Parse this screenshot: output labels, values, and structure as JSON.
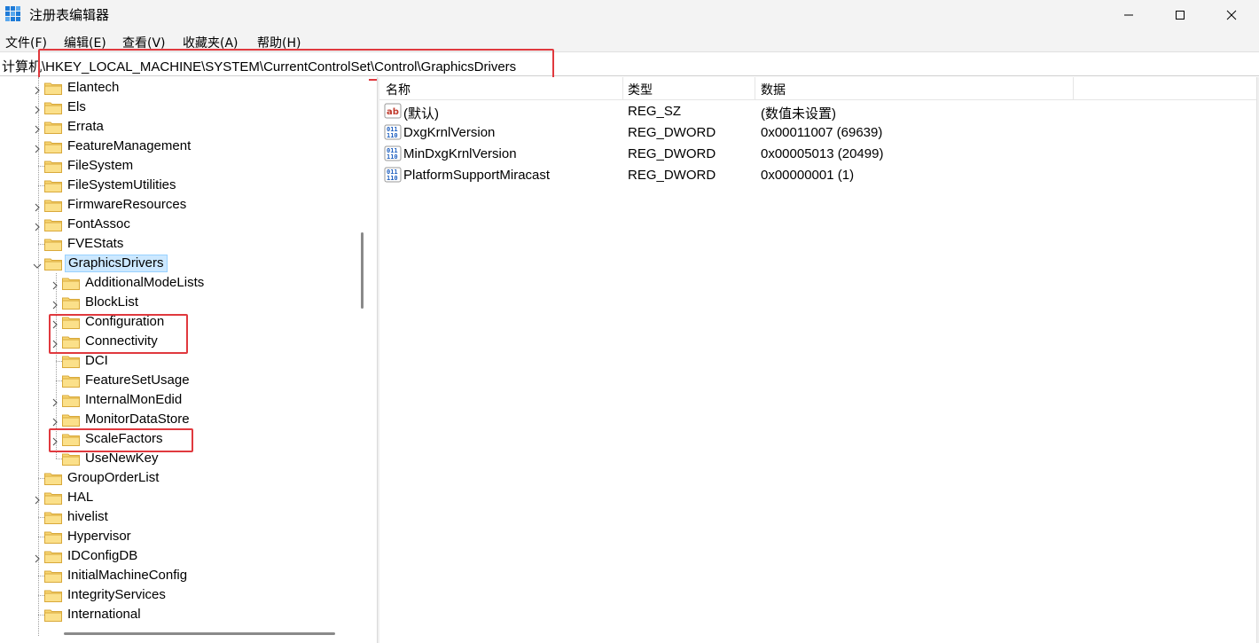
{
  "window": {
    "title": "注册表编辑器",
    "minimize_icon": "minimize-icon",
    "maximize_icon": "maximize-icon",
    "close_icon": "close-icon"
  },
  "menu": [
    {
      "label": "文件(F)"
    },
    {
      "label": "编辑(E)"
    },
    {
      "label": "查看(V)"
    },
    {
      "label": "收藏夹(A)"
    },
    {
      "label": "帮助(H)"
    }
  ],
  "address": {
    "prefix": "计算机",
    "path": "\\HKEY_LOCAL_MACHINE\\SYSTEM\\CurrentControlSet\\Control\\GraphicsDrivers"
  },
  "tree": {
    "items": [
      {
        "label": "Elantech",
        "expandable": true
      },
      {
        "label": "Els",
        "expandable": true
      },
      {
        "label": "Errata",
        "expandable": true
      },
      {
        "label": "FeatureManagement",
        "expandable": true
      },
      {
        "label": "FileSystem",
        "expandable": false
      },
      {
        "label": "FileSystemUtilities",
        "expandable": false
      },
      {
        "label": "FirmwareResources",
        "expandable": true
      },
      {
        "label": "FontAssoc",
        "expandable": true
      },
      {
        "label": "FVEStats",
        "expandable": false
      },
      {
        "label": "GraphicsDrivers",
        "expandable": true,
        "expanded": true,
        "selected": true
      },
      {
        "label": "AdditionalModeLists",
        "expandable": true,
        "child": true
      },
      {
        "label": "BlockList",
        "expandable": true,
        "child": true
      },
      {
        "label": "Configuration",
        "expandable": true,
        "child": true
      },
      {
        "label": "Connectivity",
        "expandable": true,
        "child": true
      },
      {
        "label": "DCI",
        "expandable": false,
        "child": true
      },
      {
        "label": "FeatureSetUsage",
        "expandable": false,
        "child": true
      },
      {
        "label": "InternalMonEdid",
        "expandable": true,
        "child": true
      },
      {
        "label": "MonitorDataStore",
        "expandable": true,
        "child": true
      },
      {
        "label": "ScaleFactors",
        "expandable": true,
        "child": true
      },
      {
        "label": "UseNewKey",
        "expandable": false,
        "child": true
      },
      {
        "label": "GroupOrderList",
        "expandable": false
      },
      {
        "label": "HAL",
        "expandable": true
      },
      {
        "label": "hivelist",
        "expandable": false
      },
      {
        "label": "Hypervisor",
        "expandable": false
      },
      {
        "label": "IDConfigDB",
        "expandable": true
      },
      {
        "label": "InitialMachineConfig",
        "expandable": false
      },
      {
        "label": "IntegrityServices",
        "expandable": false
      },
      {
        "label": "International",
        "expandable": false
      }
    ]
  },
  "list": {
    "columns": [
      "名称",
      "类型",
      "数据"
    ],
    "rows": [
      {
        "name": "(默认)",
        "type": "REG_SZ",
        "data": "(数值未设置)",
        "icon": "string-value-icon"
      },
      {
        "name": "DxgKrnlVersion",
        "type": "REG_DWORD",
        "data": "0x00011007 (69639)",
        "icon": "binary-value-icon"
      },
      {
        "name": "MinDxgKrnlVersion",
        "type": "REG_DWORD",
        "data": "0x00005013 (20499)",
        "icon": "binary-value-icon"
      },
      {
        "name": "PlatformSupportMiracast",
        "type": "REG_DWORD",
        "data": "0x00000001 (1)",
        "icon": "binary-value-icon"
      }
    ]
  },
  "colors": {
    "highlight_box": "#e0393e",
    "selection_bg": "#cce8ff",
    "folder": "#f8d775"
  }
}
